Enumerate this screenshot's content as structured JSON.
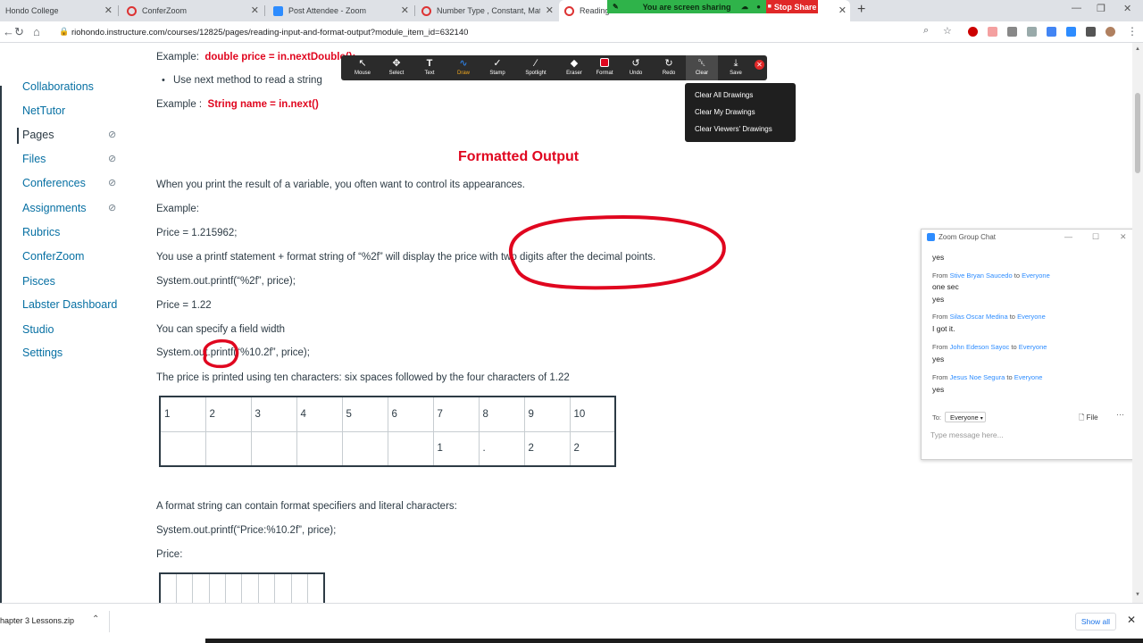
{
  "browser": {
    "tabs": [
      {
        "label": "Hondo College",
        "icon_color": "#e0e0e0"
      },
      {
        "label": "ConferZoom",
        "icon_color": "#d33"
      },
      {
        "label": "Post Attendee - Zoom",
        "icon_color": "#2d8cff"
      },
      {
        "label": "Number Type , Constant, Mathem",
        "icon_color": "#d33"
      },
      {
        "label": "Reading",
        "icon_color": "#d33"
      }
    ],
    "new_tab": "+",
    "url": "riohondo.instructure.com/courses/12825/pages/reading-input-and-format-output?module_item_id=632140"
  },
  "share_bar": {
    "sharing_text": "You are screen sharing",
    "stop_label": "Stop Share"
  },
  "leftnav": {
    "partial_item": "Collaborations",
    "items": [
      {
        "label": "NetTutor",
        "hidden": false
      },
      {
        "label": "Pages",
        "hidden": true,
        "active": true
      },
      {
        "label": "Files",
        "hidden": true
      },
      {
        "label": "Conferences",
        "hidden": true
      },
      {
        "label": "Assignments",
        "hidden": true
      },
      {
        "label": "Rubrics",
        "hidden": false
      },
      {
        "label": "ConferZoom",
        "hidden": false
      },
      {
        "label": "Pisces",
        "hidden": false
      },
      {
        "label": "Labster Dashboard",
        "hidden": false
      },
      {
        "label": "Studio",
        "hidden": false
      },
      {
        "label": "Settings",
        "hidden": false
      }
    ]
  },
  "content": {
    "example1_prefix": "Example:",
    "example1_code": "double price  = in.nextDouble();",
    "bullet": "Use next method to read a string",
    "example2_prefix": "Example :",
    "example2_code": "String name = in.next()",
    "heading": "Formatted Output",
    "p1": "When you print the result of a variable, you often want to control its appearances.",
    "p2": "Example:",
    "p3": "Price = 1.215962;",
    "p4": "You use a printf statement + format string of “%2f” will display the price with two digits after the decimal points.",
    "p5": "System.out.printf(“%2f”, price);",
    "p6": "Price = 1.22",
    "p7": "You can specify a field width",
    "p8": "System.out.printf(“%10.2f”, price);",
    "p9": "The price is printed using ten characters: six spaces followed by the four characters of 1.22",
    "table_header": [
      "1",
      "2",
      "3",
      "4",
      "5",
      "6",
      "7",
      "8",
      "9",
      "10"
    ],
    "table_row": [
      "",
      "",
      "",
      "",
      "",
      "",
      "1",
      ".",
      "2",
      "2"
    ],
    "p10": "A format string can contain format specifiers and literal characters:",
    "p11": "System.out.printf(“Price:%10.2f”, price);",
    "p12": "Price:"
  },
  "zoom_toolbar": {
    "tools": [
      {
        "label": "Mouse",
        "icon": "arrow-icon",
        "glyph": "↖"
      },
      {
        "label": "Select",
        "icon": "move-icon",
        "glyph": "✥"
      },
      {
        "label": "Text",
        "icon": "text-icon",
        "glyph": "T"
      },
      {
        "label": "Draw",
        "icon": "squiggle-icon",
        "glyph": "∿"
      },
      {
        "label": "Stamp",
        "icon": "check-icon",
        "glyph": "✓"
      },
      {
        "label": "Spotlight",
        "icon": "wand-icon",
        "glyph": "∕"
      },
      {
        "label": "Eraser",
        "icon": "eraser-icon",
        "glyph": "◆"
      },
      {
        "label": "Format",
        "icon": "color-swatch-icon",
        "glyph": "■"
      },
      {
        "label": "Undo",
        "icon": "undo-icon",
        "glyph": "↺"
      },
      {
        "label": "Redo",
        "icon": "redo-icon",
        "glyph": "↻"
      },
      {
        "label": "Clear",
        "icon": "trash-icon",
        "glyph": "␡"
      },
      {
        "label": "Save",
        "icon": "save-icon",
        "glyph": "⤓"
      }
    ],
    "format_color": "#e0061f",
    "clear_menu": [
      "Clear All Drawings",
      "Clear My Drawings",
      "Clear Viewers' Drawings"
    ]
  },
  "chat": {
    "title": "Zoom Group Chat",
    "messages": [
      {
        "from": "",
        "to": "",
        "text": "yes"
      },
      {
        "from": "Stive Bryan Saucedo",
        "to": "Everyone",
        "text": "one sec",
        "text2": "yes"
      },
      {
        "from": "Silas Oscar Medina",
        "to": "Everyone",
        "text": "I got it."
      },
      {
        "from": "John Edeson Sayoc",
        "to": "Everyone",
        "text": "yes"
      },
      {
        "from": "Jesus Noe Segura",
        "to": "Everyone",
        "text": "yes"
      }
    ],
    "from_word": "From",
    "to_word": "to",
    "to_label": "To:",
    "recipient": "Everyone",
    "file_label": "File",
    "input_placeholder": "Type message here..."
  },
  "downloads": {
    "file": "hapter 3 Lessons.zip",
    "show_all": "Show all"
  },
  "colors": {
    "canvas_red": "#e0061f",
    "link_blue": "#0770a3",
    "zoom_blue": "#2d8cff",
    "share_green": "#2fb34a"
  }
}
